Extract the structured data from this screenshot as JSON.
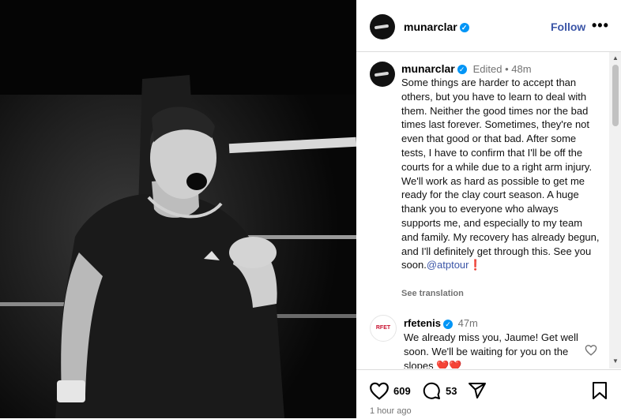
{
  "post": {
    "author": "munarclar",
    "follow_label": "Follow",
    "more_label": "•••",
    "caption_author": "munarclar",
    "caption_meta": "Edited • 48m",
    "caption_text": "Some things are harder to accept than others, but you have to learn to deal with them. Neither the good times nor the bad times last forever. Sometimes, they're not even that good or that bad. After some tests, I have to confirm that I'll be off the courts for a while due to a right arm injury. We'll work as hard as possible to get me ready for the clay court season. A huge thank you to everyone who always supports me, and especially to my team and family. My recovery has already begun, and I'll definitely get through this. See you soon.",
    "caption_mention": "@atptour",
    "caption_emoji": "❗",
    "see_translation": "See translation"
  },
  "comment": {
    "author": "rfetenis",
    "avatar_text": "RFET",
    "time": "47m",
    "text": "We already miss you, Jaume! Get well soon. We'll be waiting for you on the slopes ❤️❤️"
  },
  "actions": {
    "likes": "609",
    "comments": "53",
    "posted": "1 hour ago"
  },
  "colors": {
    "link": "#3b55a7",
    "verified": "#0095f6",
    "meta": "#737373"
  },
  "icons": [
    "heart-icon",
    "comment-icon",
    "share-icon",
    "bookmark-icon",
    "verified-icon",
    "more-icon"
  ]
}
